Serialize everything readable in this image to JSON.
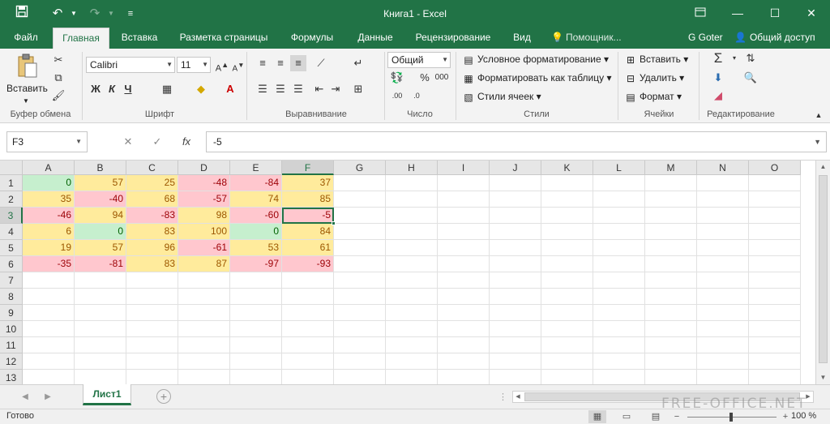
{
  "window": {
    "title": "Книга1 - Excel",
    "user": "G Goter",
    "share_label": "Общий доступ"
  },
  "quick_access": {
    "save_icon": "save-icon",
    "undo_icon": "undo-icon",
    "redo_icon": "redo-icon"
  },
  "tabs": [
    {
      "label": "Файл",
      "active": false
    },
    {
      "label": "Главная",
      "active": true
    },
    {
      "label": "Вставка",
      "active": false
    },
    {
      "label": "Разметка страницы",
      "active": false
    },
    {
      "label": "Формулы",
      "active": false
    },
    {
      "label": "Данные",
      "active": false
    },
    {
      "label": "Рецензирование",
      "active": false
    },
    {
      "label": "Вид",
      "active": false
    }
  ],
  "tell_me": "Помощник...",
  "ribbon": {
    "clipboard": {
      "paste_label": "Вставить",
      "group_label": "Буфер обмена"
    },
    "font": {
      "font_name": "Calibri",
      "font_size": "11",
      "bold": "Ж",
      "italic": "К",
      "underline": "Ч",
      "group_label": "Шрифт"
    },
    "alignment": {
      "group_label": "Выравнивание"
    },
    "number": {
      "format": "Общий",
      "percent": "%",
      "thousands": "000",
      "group_label": "Число"
    },
    "styles": {
      "conditional": "Условное форматирование",
      "as_table": "Форматировать как таблицу",
      "cell_styles": "Стили ячеек",
      "group_label": "Стили"
    },
    "cells": {
      "insert": "Вставить",
      "delete": "Удалить",
      "format": "Формат",
      "group_label": "Ячейки"
    },
    "editing": {
      "group_label": "Редактирование"
    }
  },
  "formula_bar": {
    "name_box": "F3",
    "fx": "fx",
    "formula": "-5"
  },
  "grid": {
    "columns": [
      "A",
      "B",
      "C",
      "D",
      "E",
      "F",
      "G",
      "H",
      "I",
      "J",
      "K",
      "L",
      "M",
      "N",
      "O"
    ],
    "rows": [
      "1",
      "2",
      "3",
      "4",
      "5",
      "6",
      "7",
      "8",
      "9",
      "10",
      "11",
      "12",
      "13"
    ],
    "selected_cell": "F3",
    "data": [
      [
        {
          "v": "0",
          "s": "green"
        },
        {
          "v": "57",
          "s": "yellow"
        },
        {
          "v": "25",
          "s": "yellow"
        },
        {
          "v": "-48",
          "s": "red"
        },
        {
          "v": "-84",
          "s": "red"
        },
        {
          "v": "37",
          "s": "yellow"
        }
      ],
      [
        {
          "v": "35",
          "s": "yellow"
        },
        {
          "v": "-40",
          "s": "red"
        },
        {
          "v": "68",
          "s": "yellow"
        },
        {
          "v": "-57",
          "s": "red"
        },
        {
          "v": "74",
          "s": "yellow"
        },
        {
          "v": "85",
          "s": "yellow"
        }
      ],
      [
        {
          "v": "-46",
          "s": "red"
        },
        {
          "v": "94",
          "s": "yellow"
        },
        {
          "v": "-83",
          "s": "red"
        },
        {
          "v": "98",
          "s": "yellow"
        },
        {
          "v": "-60",
          "s": "red"
        },
        {
          "v": "-5",
          "s": "red"
        }
      ],
      [
        {
          "v": "6",
          "s": "yellow"
        },
        {
          "v": "0",
          "s": "green"
        },
        {
          "v": "83",
          "s": "yellow"
        },
        {
          "v": "100",
          "s": "yellow"
        },
        {
          "v": "0",
          "s": "green"
        },
        {
          "v": "84",
          "s": "yellow"
        }
      ],
      [
        {
          "v": "19",
          "s": "yellow"
        },
        {
          "v": "57",
          "s": "yellow"
        },
        {
          "v": "96",
          "s": "yellow"
        },
        {
          "v": "-61",
          "s": "red"
        },
        {
          "v": "53",
          "s": "yellow"
        },
        {
          "v": "61",
          "s": "yellow"
        }
      ],
      [
        {
          "v": "-35",
          "s": "red"
        },
        {
          "v": "-81",
          "s": "red"
        },
        {
          "v": "83",
          "s": "yellow"
        },
        {
          "v": "87",
          "s": "yellow"
        },
        {
          "v": "-97",
          "s": "red"
        },
        {
          "v": "-93",
          "s": "red"
        }
      ]
    ]
  },
  "sheets": [
    {
      "label": "Лист1",
      "active": true
    }
  ],
  "status": {
    "text": "Готово",
    "zoom": "100 %"
  },
  "watermark": "FREE-OFFICE.NET",
  "colors": {
    "accent": "#217346",
    "good_fill": "#c6efce",
    "neutral_fill": "#ffeb9c",
    "bad_fill": "#ffc7ce"
  }
}
